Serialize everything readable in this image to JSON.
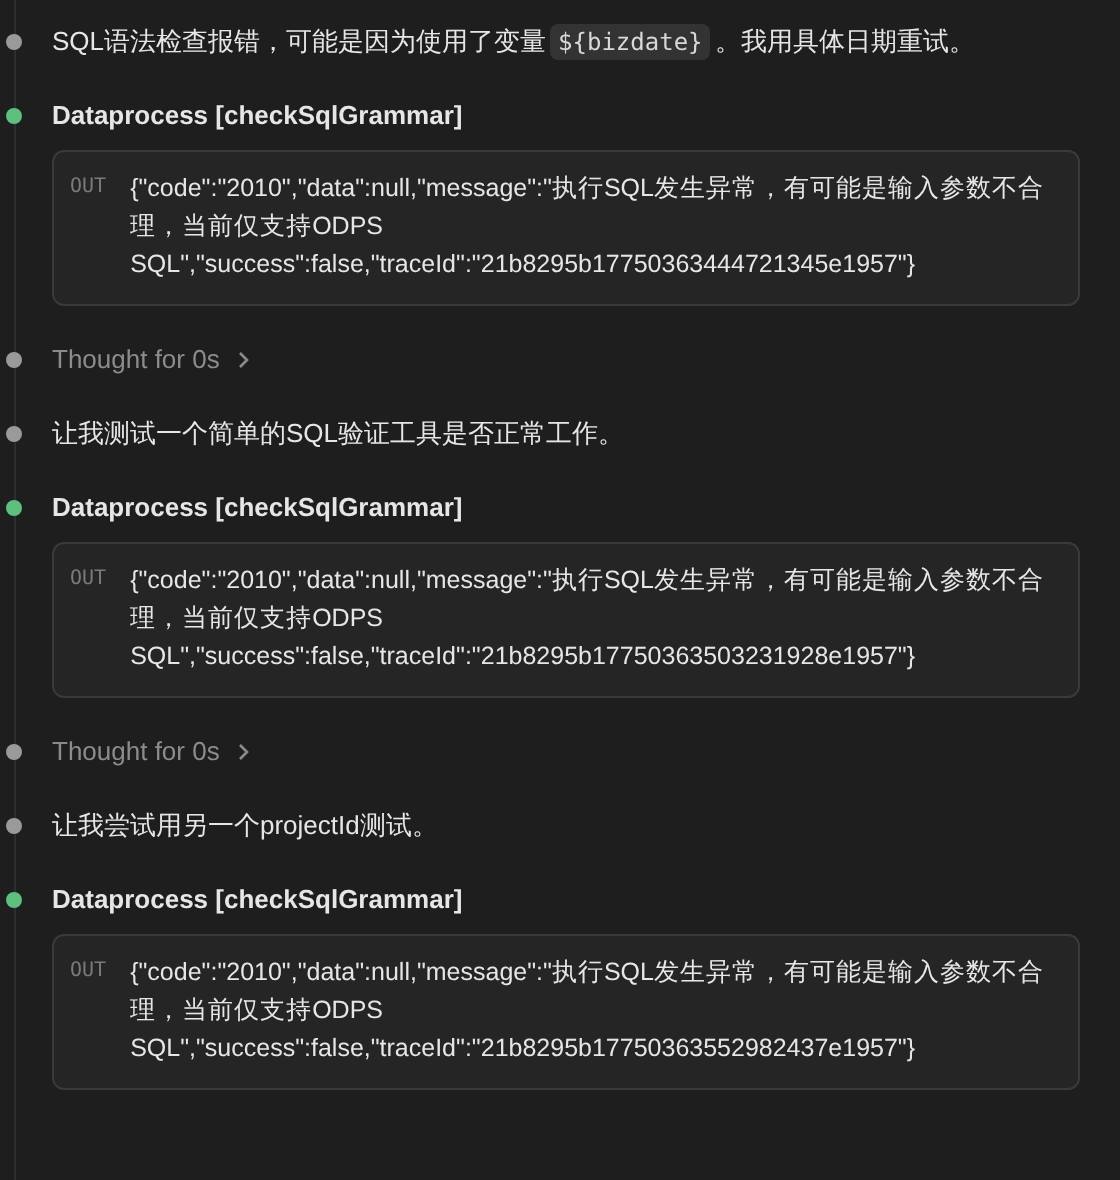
{
  "timeline": [
    {
      "kind": "message",
      "parts": [
        {
          "kind": "text",
          "text": "SQL语法检查报错，可能是因为使用了变量"
        },
        {
          "kind": "code",
          "text": "${bizdate}"
        },
        {
          "kind": "text",
          "text": "。我用具体日期重试。"
        }
      ]
    },
    {
      "kind": "tool",
      "title": "Dataprocess [checkSqlGrammar]",
      "output_label": "OUT",
      "output": "{\"code\":\"2010\",\"data\":null,\"message\":\"执行SQL发生异常，有可能是输入参数不合理，当前仅支持ODPS SQL\",\"success\":false,\"traceId\":\"21b8295b17750363444721345e1957\"}"
    },
    {
      "kind": "thought",
      "text": "Thought for 0s",
      "expanded": false
    },
    {
      "kind": "message",
      "parts": [
        {
          "kind": "text",
          "text": "让我测试一个简单的SQL验证工具是否正常工作。"
        }
      ]
    },
    {
      "kind": "tool",
      "title": "Dataprocess [checkSqlGrammar]",
      "output_label": "OUT",
      "output": "{\"code\":\"2010\",\"data\":null,\"message\":\"执行SQL发生异常，有可能是输入参数不合理，当前仅支持ODPS SQL\",\"success\":false,\"traceId\":\"21b8295b17750363503231928e1957\"}"
    },
    {
      "kind": "thought",
      "text": "Thought for 0s",
      "expanded": false
    },
    {
      "kind": "message",
      "parts": [
        {
          "kind": "text",
          "text": "让我尝试用另一个projectId测试。"
        }
      ]
    },
    {
      "kind": "tool",
      "title": "Dataprocess [checkSqlGrammar]",
      "output_label": "OUT",
      "output": "{\"code\":\"2010\",\"data\":null,\"message\":\"执行SQL发生异常，有可能是输入参数不合理，当前仅支持ODPS SQL\",\"success\":false,\"traceId\":\"21b8295b17750363552982437e1957\"}"
    }
  ]
}
